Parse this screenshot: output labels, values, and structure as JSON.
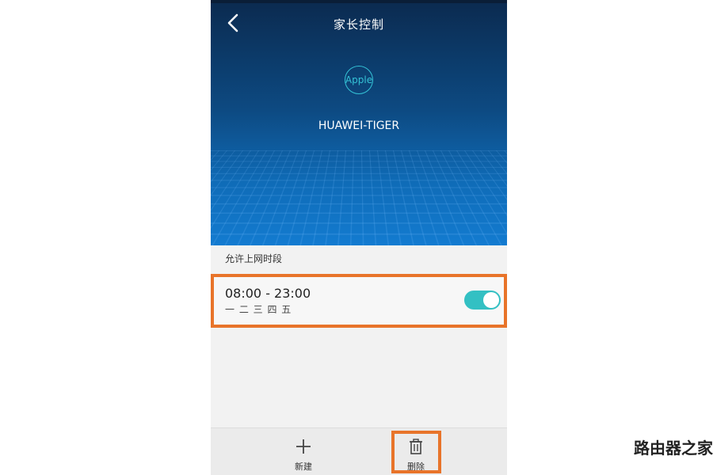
{
  "header": {
    "title": "家长控制",
    "back_icon": "chevron-left-icon",
    "device_icon_text": "Apple",
    "device_name": "HUAWEI-TIGER"
  },
  "schedule": {
    "section_label": "允许上网时段",
    "rules": [
      {
        "time": "08:00 - 23:00",
        "days": "一 二 三 四 五",
        "enabled": true
      }
    ]
  },
  "bottom_bar": {
    "new_label": "新建",
    "new_icon": "plus-icon",
    "delete_label": "删除",
    "delete_icon": "trash-icon"
  },
  "watermark": "路由器之家",
  "colors": {
    "accent": "#33c0c3",
    "highlight": "#e8742a",
    "header_top": "#0b2a4f",
    "header_bottom": "#137bd0"
  }
}
